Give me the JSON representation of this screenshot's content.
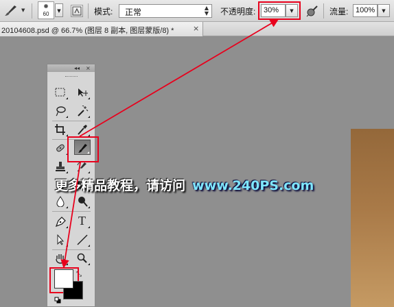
{
  "options_bar": {
    "brush_size": "60",
    "mode_label": "模式:",
    "mode_value": "正常",
    "opacity_label": "不透明度:",
    "opacity_value": "30%",
    "flow_label": "流量:",
    "flow_value": "100%"
  },
  "document_tab": {
    "title": "20104608.psd @ 66.7% (图层 8 副本, 图层蒙版/8) *",
    "close_glyph": "×"
  },
  "tools_panel": {
    "collapse_glyph": "◂◂",
    "close_glyph": "×",
    "tools": [
      "rectangular-marquee",
      "move",
      "lasso",
      "magic-wand",
      "crop",
      "eyedropper",
      "spot-healing-brush",
      "brush",
      "clone-stamp",
      "history-brush",
      "eraser",
      "gradient",
      "blur",
      "dodge",
      "pen",
      "type",
      "path-selection",
      "line",
      "hand",
      "zoom"
    ],
    "active_tool": "brush",
    "type_tool_glyph": "T",
    "foreground_color": "#ffffff",
    "background_color": "#000000",
    "swap_glyph": "⤡"
  },
  "watermark": {
    "chinese_text": "更多精品教程，请访问",
    "url_text": "www.240PS.com"
  },
  "annotation_color": "#e8001c"
}
